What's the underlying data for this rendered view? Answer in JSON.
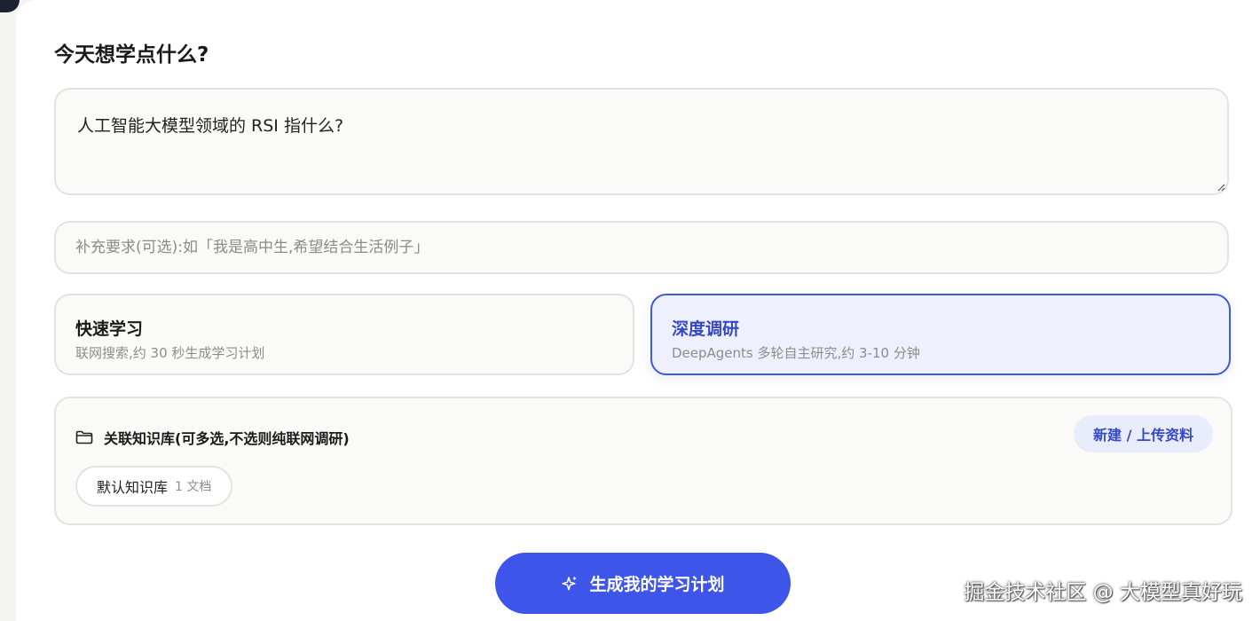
{
  "page": {
    "heading": "今天想学点什么?"
  },
  "question": {
    "value": "人工智能大模型领域的 RSI 指什么?"
  },
  "extra": {
    "placeholder": "补充要求(可选):如「我是高中生,希望结合生活例子」"
  },
  "modes": [
    {
      "title": "快速学习",
      "desc": "联网搜索,约 30 秒生成学习计划",
      "selected": false
    },
    {
      "title": "深度调研",
      "desc": "DeepAgents 多轮自主研究,约 3-10 分钟",
      "selected": true
    }
  ],
  "knowledge": {
    "title": "关联知识库(可多选,不选则纯联网调研)",
    "new_button": "新建 / 上传资料",
    "chips": [
      {
        "name": "默认知识库",
        "count": "1 文档"
      }
    ]
  },
  "generate": {
    "label": "生成我的学习计划"
  },
  "watermark": "掘金技术社区 @ 大模型真好玩",
  "colors": {
    "accent": "#3d55e8",
    "selected_border": "#3f5bd3",
    "selected_bg": "#eef0fd"
  },
  "icons": {
    "folder": "folder-icon",
    "sparkle": "sparkle-icon"
  }
}
